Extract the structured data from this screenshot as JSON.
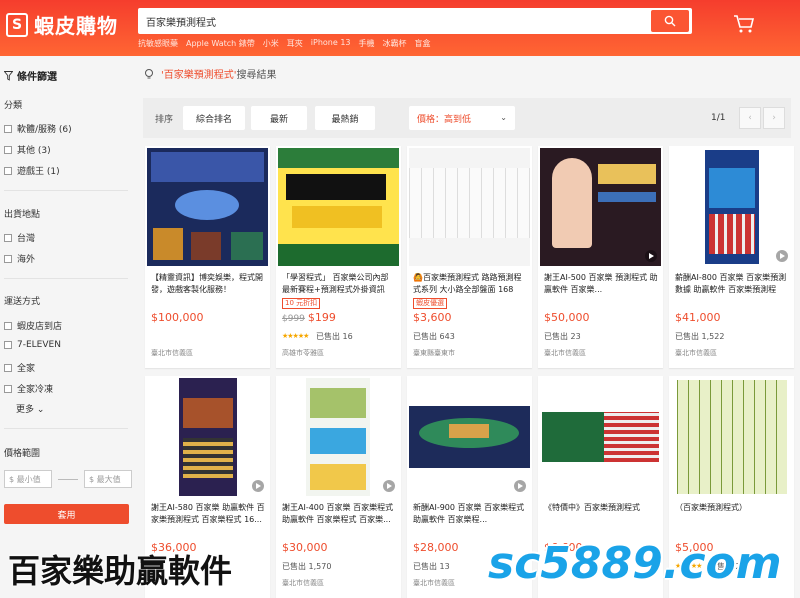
{
  "brand": {
    "name": "蝦皮購物",
    "letter": "S"
  },
  "search": {
    "value": "百家樂預測程式"
  },
  "hot_words": [
    "抗敏感眼藥",
    "Apple Watch 錶帶",
    "小米",
    "耳夾",
    "iPhone 13",
    "手機",
    "冰霸杯",
    "盲盒"
  ],
  "sidebar": {
    "filter_title": "條件篩選",
    "category_title": "分類",
    "categories": [
      "軟體/服務 (6)",
      "其他 (3)",
      "遊戲王 (1)"
    ],
    "ship_from_title": "出貨地點",
    "ship_from": [
      "台灣",
      "海外"
    ],
    "shipping_title": "運送方式",
    "shipping": [
      "蝦皮店到店",
      "7-ELEVEN",
      "全家",
      "全家冷凍"
    ],
    "more_label": "更多",
    "price_title": "價格範圍",
    "min_placeholder": "$ 最小值",
    "max_placeholder": "$ 最大值",
    "apply_label": "套用"
  },
  "result_hint": {
    "keyword": "'百家樂預測程式'",
    "suffix": "搜尋結果"
  },
  "sortbar": {
    "label": "排序",
    "options": [
      "綜合排名",
      "最新",
      "最熱銷"
    ],
    "price_label": "價格：高到低",
    "page": "1/1"
  },
  "products": [
    {
      "title": "【精靈資訊】博奕娛樂，程式開發，遊戲客製化服務！",
      "price": "$100,000",
      "sold": "",
      "location": "臺北市信義區",
      "tag": "",
      "orig": "",
      "stars": false,
      "video": false,
      "thumb": "p1"
    },
    {
      "title": "「學習程式」 百家樂公司內部最新賽程+預測程式外掛資訊",
      "price": "$199",
      "orig": "$999",
      "sold": "已售出 16",
      "location": "高雄市苓雅區",
      "tag": "10 元折扣",
      "stars": true,
      "video": false,
      "thumb": "p2"
    },
    {
      "title": "🙆百家樂預測程式 路路預測程式系列 大小路全部盤面 168牌...",
      "price": "$3,600",
      "sold": "已售出 643",
      "location": "臺東縣臺東市",
      "tag": "蝦皮優選",
      "orig": "",
      "stars": false,
      "video": false,
      "thumb": "p3"
    },
    {
      "title": "謝王AI-500 百家樂 預測程式 助贏軟件 百家樂...",
      "price": "$50,000",
      "sold": "已售出 23",
      "location": "臺北市信義區",
      "tag": "",
      "orig": "",
      "stars": false,
      "video": true,
      "thumb": "p4"
    },
    {
      "title": "薪酬AI-800 百家樂 百家樂預測數據 助贏軟件 百家樂預測程",
      "price": "$41,000",
      "sold": "已售出 1,522",
      "location": "臺北市信義區",
      "tag": "",
      "orig": "",
      "stars": false,
      "video": true,
      "thumb": "p5"
    },
    {
      "title": "謝王AI-580 百家樂 助贏軟件 百家樂預測程式 百家樂程式 16...",
      "price": "$36,000",
      "sold": "",
      "location": "",
      "tag": "",
      "orig": "",
      "stars": false,
      "video": true,
      "thumb": "p6"
    },
    {
      "title": "謝王AI-400 百家樂 百家樂程式 助贏軟件 百家樂程式 百家樂...",
      "price": "$30,000",
      "sold": "已售出 1,570",
      "location": "臺北市信義區",
      "tag": "",
      "orig": "",
      "stars": false,
      "video": true,
      "thumb": "p7"
    },
    {
      "title": "新酬AI-900 百家樂 百家樂程式 助贏軟件 百家樂程...",
      "price": "$28,000",
      "sold": "已售出 13",
      "location": "臺北市信義區",
      "tag": "",
      "orig": "",
      "stars": false,
      "video": true,
      "thumb": "p8"
    },
    {
      "title": "《特價中》百家樂預測程式",
      "price": "$6,600",
      "sold": "",
      "location": "",
      "tag": "",
      "orig": "",
      "stars": false,
      "video": false,
      "thumb": "p9"
    },
    {
      "title": "（百家樂預測程式）",
      "price": "$5,000",
      "sold": "已售出 2",
      "location": "",
      "tag": "",
      "orig": "",
      "stars": true,
      "video": false,
      "thumb": "p10"
    }
  ],
  "watermark": {
    "left": "百家樂助贏軟件",
    "right": "sc5889.com"
  },
  "colors": {
    "brand": "#ee4d2d",
    "header_from": "#f53d2d",
    "header_to": "#ff6633",
    "watermark_blue": "#1aa3e8"
  }
}
